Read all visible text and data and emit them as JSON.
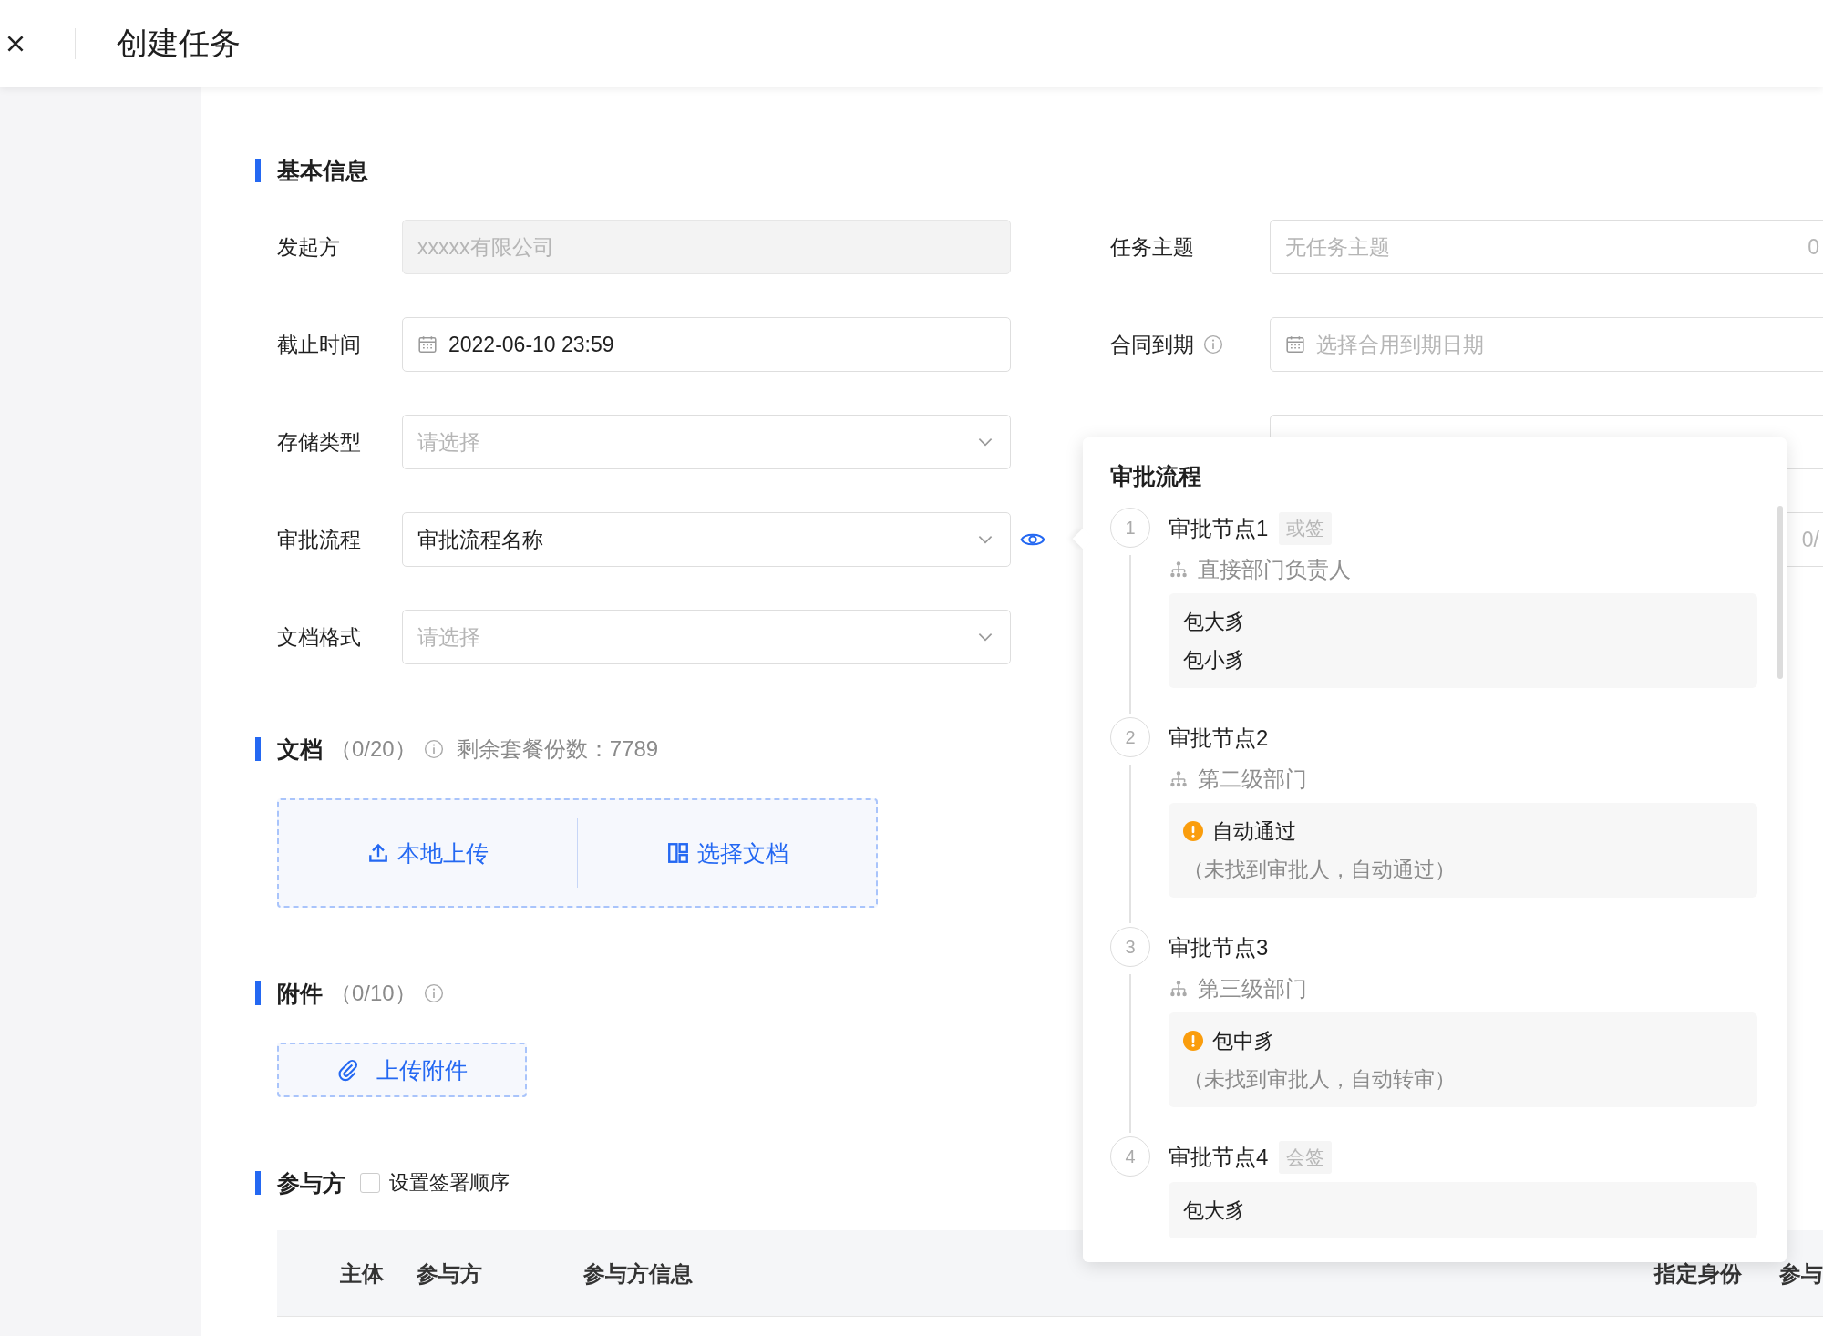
{
  "header": {
    "title": "创建任务"
  },
  "basic_info": {
    "title": "基本信息",
    "left_fields": [
      {
        "kind": "text",
        "label": "发起方",
        "value": "xxxxx有限公司",
        "disabled": true
      },
      {
        "kind": "date",
        "label": "截止时间",
        "value": "2022-06-10 23:59",
        "disabled": false
      },
      {
        "kind": "select",
        "label": "存储类型",
        "placeholder": "请选择"
      },
      {
        "kind": "select_preview",
        "label": "审批流程",
        "value": "审批流程名称"
      },
      {
        "kind": "select",
        "label": "文档格式",
        "placeholder": "请选择"
      }
    ],
    "right_fields": [
      {
        "kind": "text",
        "label": "任务主题",
        "placeholder": "无任务主题",
        "counter": "0"
      },
      {
        "kind": "date_info",
        "label": "合同到期",
        "placeholder": "选择合用到期日期"
      },
      {
        "kind": "select"
      },
      {
        "kind": "text",
        "counter": "0/"
      }
    ]
  },
  "documents": {
    "title": "文档",
    "count": "（0/20）",
    "quota": "剩余套餐份数：7789",
    "buttons": [
      {
        "kind": "upload",
        "label": "本地上传"
      },
      {
        "kind": "select",
        "label": "选择文档"
      }
    ]
  },
  "attachments": {
    "title": "附件",
    "count": "（0/10）",
    "button": "上传附件"
  },
  "participants": {
    "title": "参与方",
    "order_checkbox": {
      "label": "设置签署顺序",
      "checked": false
    },
    "columns": [
      "主体",
      "参与方",
      "参与方信息",
      "指定身份",
      "参与"
    ]
  },
  "approval_popover": {
    "title": "审批流程",
    "nodes": [
      {
        "index": "1",
        "name": "审批节点1",
        "tag": "或签",
        "department": "直接部门负责人",
        "approvers": [
          {
            "name": "包大豸",
            "warning": false
          },
          {
            "name": "包小豸",
            "warning": false
          }
        ]
      },
      {
        "index": "2",
        "name": "审批节点2",
        "department": "第二级部门",
        "approvers": [
          {
            "name": "自动通过",
            "warning": true,
            "note": "（未找到审批人，自动通过）"
          }
        ]
      },
      {
        "index": "3",
        "name": "审批节点3",
        "department": "第三级部门",
        "approvers": [
          {
            "name": "包中豸",
            "warning": true,
            "note": "（未找到审批人，自动转审）"
          }
        ]
      },
      {
        "index": "4",
        "name": "审批节点4",
        "tag": "会签",
        "approvers": [
          {
            "name": "包大豸",
            "warning": false
          }
        ]
      }
    ]
  }
}
